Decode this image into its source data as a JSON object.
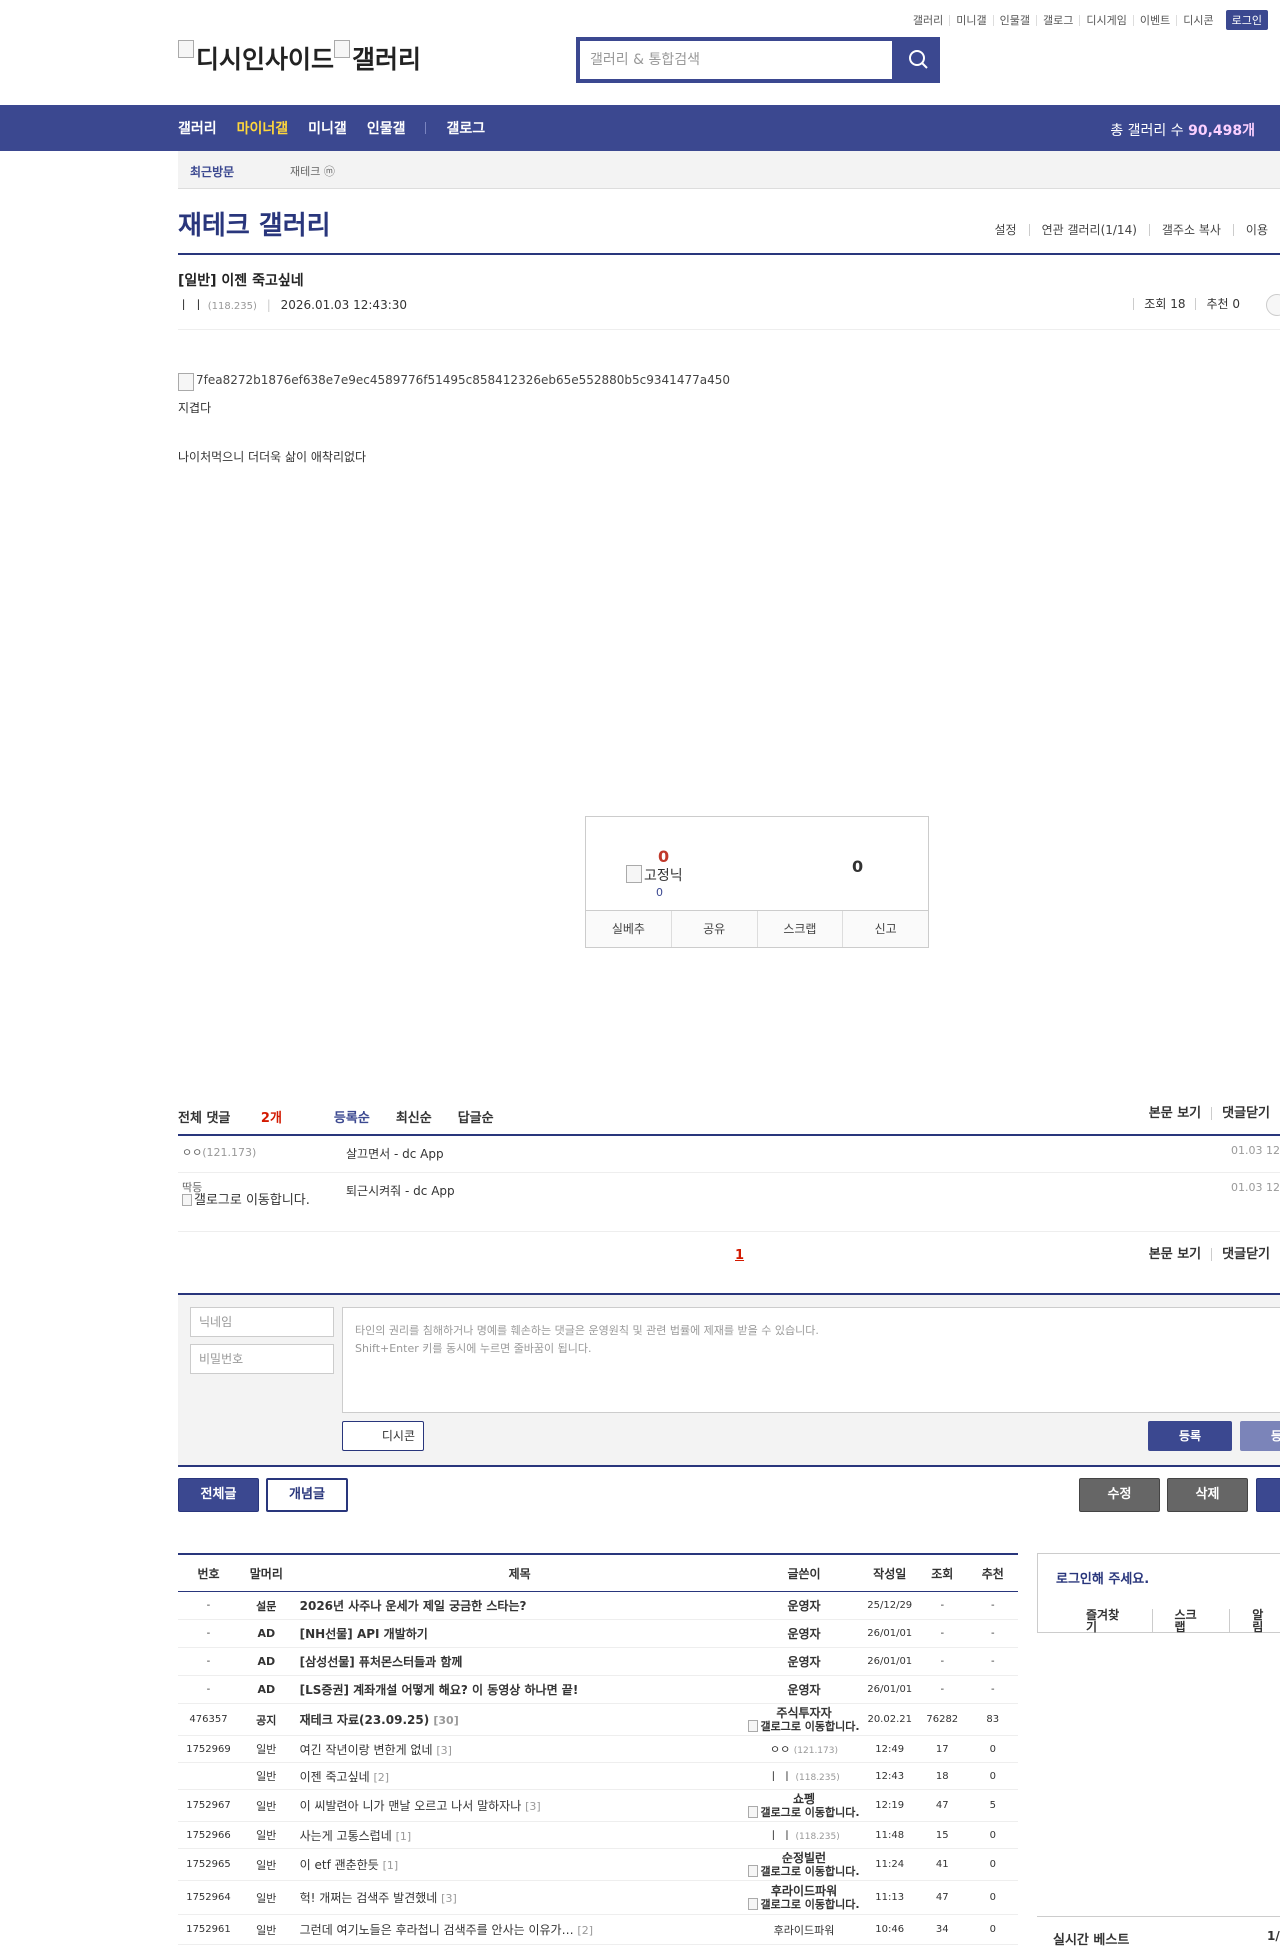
{
  "top_links": [
    "갤러리",
    "미니갤",
    "인물갤",
    "갤로그",
    "디시게임",
    "이벤트",
    "디시콘"
  ],
  "login_label": "로그인",
  "logo": {
    "alt1": "디시인사이드",
    "alt2": "갤러리"
  },
  "search": {
    "placeholder": "갤러리 & 통합검색"
  },
  "gnb": {
    "items": [
      "갤러리",
      "마이너갤",
      "미니갤",
      "인물갤",
      "갤로그"
    ],
    "total_label": "총 갤러리 수 ",
    "total_count": "90,498개"
  },
  "recent": {
    "label": "최근방문",
    "item": "재테크 ⓜ"
  },
  "gallery": {
    "title": "재테크 갤러리",
    "menu": [
      "설정",
      "연관 갤러리(1/14)",
      "갤주소 복사",
      "이용"
    ]
  },
  "post": {
    "title": "[일반] 이젠 죽고싶네",
    "author": "ㅣ ㅣ",
    "ip": "(118.235)",
    "datetime": "2026.01.03 12:43:30",
    "views": "조회 18",
    "recommend": "추천 0",
    "image_alt": "7fea8272b1876ef638e7e9ec4589776f51495c858412326eb65e552880b5c9341477a450",
    "lines": [
      "지겹다",
      "나이처먹으니 더더욱 삶이 애착리없다"
    ]
  },
  "vote": {
    "up": "0",
    "fixnick": "고정닉",
    "fix_count": "0",
    "down": "0",
    "buttons": [
      "실베추",
      "공유",
      "스크랩",
      "신고"
    ]
  },
  "comments": {
    "head_prefix": "전체 댓글 ",
    "count": "2개",
    "sorts": [
      "등록순",
      "최신순",
      "답글순"
    ],
    "options": [
      "본문 보기",
      "댓글닫기"
    ],
    "items": [
      {
        "nick": "ㅇㅇ",
        "ip": "(121.173)",
        "text": "살끄면서 - dc App",
        "time": "01.03 12"
      },
      {
        "nick": "딱등",
        "gallog": "갤로그로 이동합니다.",
        "text": "퇴근시켜줘 - dc App",
        "time": "01.03 12"
      }
    ],
    "page": "1",
    "write": {
      "nick_placeholder": "닉네임",
      "pw_placeholder": "비밀번호",
      "notice1": "타인의 권리를 침해하거나 명예를 훼손하는 댓글은 운영원칙 및 관련 법률에 제재를 받을 수 있습니다.",
      "notice2": "Shift+Enter 키를 동시에 누르면 줄바꿈이 됩니다.",
      "dccon": "디시콘",
      "register": "등록",
      "register2": "등록"
    }
  },
  "actions": {
    "all": "전체글",
    "concept": "개념글",
    "edit": "수정",
    "delete": "삭제"
  },
  "list": {
    "headers": [
      "번호",
      "말머리",
      "제목",
      "글쓴이",
      "작성일",
      "조회",
      "추천"
    ],
    "rows": [
      {
        "no": "-",
        "head": "설문",
        "title": "2026년 사주나 운세가 제일 궁금한 스타는?",
        "rc": "",
        "writer": "운영자",
        "date": "25/12/29",
        "views": "-",
        "rec": "-",
        "bold": true
      },
      {
        "no": "-",
        "head": "AD",
        "title": "[NH선물] API 개발하기",
        "rc": "",
        "writer": "운영자",
        "date": "26/01/01",
        "views": "-",
        "rec": "-",
        "bold": true
      },
      {
        "no": "-",
        "head": "AD",
        "title": "[삼성선물] 퓨처몬스터들과 함께",
        "rc": "",
        "writer": "운영자",
        "date": "26/01/01",
        "views": "-",
        "rec": "-",
        "bold": true
      },
      {
        "no": "-",
        "head": "AD",
        "title": "[LS증권] 계좌개설 어떻게 해요? 이 동영상 하나면 끝!",
        "rc": "",
        "writer": "운영자",
        "date": "26/01/01",
        "views": "-",
        "rec": "-",
        "bold": true
      },
      {
        "no": "476357",
        "head": "공지",
        "title": "재테크 자료(23.09.25)",
        "rc": "[30]",
        "writer": "주식투자자",
        "gallog": "갤로그로 이동합니다.",
        "date": "20.02.21",
        "views": "76282",
        "rec": "83",
        "bold": true
      },
      {
        "no": "1752969",
        "head": "일반",
        "title": "여긴 작년이랑 변한게 없네",
        "rc": "[3]",
        "writer": "ㅇㅇ",
        "ip": "(121.173)",
        "date": "12:49",
        "views": "17",
        "rec": "0",
        "bold": false
      },
      {
        "no": "",
        "head": "일반",
        "title": "이젠 죽고싶네",
        "rc": "[2]",
        "writer": "ㅣ ㅣ",
        "ip": "(118.235)",
        "date": "12:43",
        "views": "18",
        "rec": "0",
        "bold": false
      },
      {
        "no": "1752967",
        "head": "일반",
        "title": "이 씨발련아 니가 맨날 오르고 나서 말하자나",
        "rc": "[3]",
        "writer": "쇼펭",
        "gallog": "갤로그로 이동합니다.",
        "date": "12:19",
        "views": "47",
        "rec": "5",
        "bold": false
      },
      {
        "no": "1752966",
        "head": "일반",
        "title": "사는게 고통스럽네",
        "rc": "[1]",
        "writer": "ㅣ ㅣ",
        "ip": "(118.235)",
        "date": "11:48",
        "views": "15",
        "rec": "0",
        "bold": false
      },
      {
        "no": "1752965",
        "head": "일반",
        "title": "이 etf 괜춘한듯",
        "rc": "[1]",
        "writer": "순정빌런",
        "gallog": "갤로그로 이동합니다.",
        "date": "11:24",
        "views": "41",
        "rec": "0",
        "bold": false
      },
      {
        "no": "1752964",
        "head": "일반",
        "title": "헉! 개쩌는 검색주 발견했네",
        "rc": "[3]",
        "writer": "후라이드파워",
        "gallog": "갤로그로 이동합니다.",
        "date": "11:13",
        "views": "47",
        "rec": "0",
        "bold": false
      },
      {
        "no": "1752961",
        "head": "일반",
        "title": "그런데 여기노들은 후라첩니 검색주를 안사는 이유가…",
        "rc": "[2]",
        "writer": "후라이드파워",
        "gallog": "",
        "date": "10:46",
        "views": "34",
        "rec": "0",
        "bold": false
      }
    ]
  },
  "sidebar": {
    "login_title": "로그인해 주세요.",
    "links": [
      "즐겨찾기",
      "스크랩",
      "알림"
    ],
    "best_title": "실시간 베스트",
    "best_page": "1/"
  }
}
